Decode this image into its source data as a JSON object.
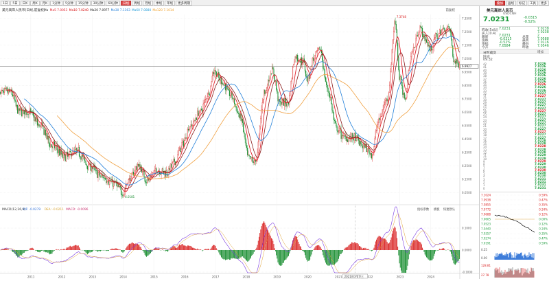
{
  "toolbar": {
    "left": [
      "1日",
      "5日",
      "日K",
      "周K",
      "月K",
      "1分钟",
      "5分钟",
      "15分钟",
      "30分钟",
      "60分钟",
      "日线",
      "周线",
      "月线",
      "季线",
      "年线",
      "更多周期"
    ],
    "active_index": 10,
    "right": [
      "叠加",
      "画线",
      "标记",
      "工具",
      "更多"
    ]
  },
  "chart": {
    "title": "美元离岸人民币",
    "subtitle": "(日线,前复权)",
    "ma_legend": [
      {
        "label": "Ma",
        "value": "",
        "color": "#333333"
      },
      {
        "label": "Ma5",
        "value": "7.0053",
        "color": "#e0202a"
      },
      {
        "label": "Ma10",
        "value": "7.0240",
        "color": "#d40000"
      },
      {
        "label": "Ma20",
        "value": "7.0977",
        "color": "#222222"
      },
      {
        "label": "Ma30",
        "value": "7.1163",
        "color": "#1f7ed8"
      },
      {
        "label": "Ma60",
        "value": "7.0880",
        "color": "#1f9bd8"
      },
      {
        "label": "Ma120",
        "value": "7.1014",
        "color": "#f0a02a"
      }
    ],
    "ma_colors": {
      "ma_fast": "#e0202a",
      "ma_mid": "#8b1a1a",
      "ma_slow": "#1f7ed8",
      "ma_long": "#f0a040"
    },
    "right_top_label": "前复权",
    "y_axis": [
      "7.3500",
      "7.2500",
      "7.1500",
      "7.0500",
      "6.9500",
      "6.8500",
      "6.7500",
      "6.6500",
      "6.5500",
      "6.4500",
      "6.3500",
      "6.2500",
      "6.1500",
      "6.0500"
    ],
    "crosshair_value": "6.9927",
    "high_label": "7.3748",
    "low_label": "6.0181",
    "x_labels": [
      "2011",
      "2012",
      "2013",
      "2014",
      "2015",
      "2016",
      "2017",
      "2018",
      "2019",
      "2020",
      "2021",
      "2022",
      "2023",
      "2024"
    ],
    "crosshair_date": "2021/07/07/三",
    "macd_title": "MACD(12,26,9)",
    "macd_values": [
      {
        "label": "DIF",
        "value": "-0.0279",
        "color": "#2b6cd6"
      },
      {
        "label": "DEA",
        "value": "-0.0211",
        "color": "#d6a02b"
      },
      {
        "label": "MACD",
        "value": "-0.0096",
        "color": "#c8306e"
      }
    ],
    "macd_buttons": [
      "指标参数",
      "模板",
      "恢复默认"
    ],
    "macd_axis": [
      "0.1000",
      "0.0000",
      "-0.1000"
    ]
  },
  "chart_data": {
    "type": "line",
    "x_range": [
      "2010",
      "2024"
    ],
    "y_range": [
      6.0,
      7.38
    ],
    "keypoints": [
      {
        "year": 2010.35,
        "price": 6.8
      },
      {
        "year": 2010.6,
        "price": 6.66
      },
      {
        "year": 2010.95,
        "price": 6.65
      },
      {
        "year": 2011.3,
        "price": 6.55
      },
      {
        "year": 2011.7,
        "price": 6.4
      },
      {
        "year": 2012.1,
        "price": 6.32
      },
      {
        "year": 2012.5,
        "price": 6.36
      },
      {
        "year": 2012.9,
        "price": 6.25
      },
      {
        "year": 2013.3,
        "price": 6.17
      },
      {
        "year": 2013.7,
        "price": 6.12
      },
      {
        "year": 2014.0,
        "price": 6.05
      },
      {
        "year": 2014.2,
        "price": 6.15
      },
      {
        "year": 2014.5,
        "price": 6.25
      },
      {
        "year": 2014.8,
        "price": 6.14
      },
      {
        "year": 2015.1,
        "price": 6.22
      },
      {
        "year": 2015.4,
        "price": 6.2
      },
      {
        "year": 2015.7,
        "price": 6.28
      },
      {
        "year": 2015.9,
        "price": 6.4
      },
      {
        "year": 2016.2,
        "price": 6.55
      },
      {
        "year": 2016.5,
        "price": 6.65
      },
      {
        "year": 2016.8,
        "price": 6.8
      },
      {
        "year": 2016.95,
        "price": 6.96
      },
      {
        "year": 2017.2,
        "price": 6.88
      },
      {
        "year": 2017.5,
        "price": 6.78
      },
      {
        "year": 2017.8,
        "price": 6.62
      },
      {
        "year": 2018.1,
        "price": 6.3
      },
      {
        "year": 2018.3,
        "price": 6.28
      },
      {
        "year": 2018.6,
        "price": 6.8
      },
      {
        "year": 2018.85,
        "price": 6.96
      },
      {
        "year": 2019.1,
        "price": 6.72
      },
      {
        "year": 2019.35,
        "price": 6.72
      },
      {
        "year": 2019.6,
        "price": 7.06
      },
      {
        "year": 2019.85,
        "price": 7.03
      },
      {
        "year": 2020.0,
        "price": 6.9
      },
      {
        "year": 2020.2,
        "price": 7.05
      },
      {
        "year": 2020.4,
        "price": 7.12
      },
      {
        "year": 2020.65,
        "price": 6.82
      },
      {
        "year": 2020.95,
        "price": 6.52
      },
      {
        "year": 2021.2,
        "price": 6.46
      },
      {
        "year": 2021.5,
        "price": 6.46
      },
      {
        "year": 2021.8,
        "price": 6.4
      },
      {
        "year": 2022.1,
        "price": 6.34
      },
      {
        "year": 2022.3,
        "price": 6.58
      },
      {
        "year": 2022.6,
        "price": 6.76
      },
      {
        "year": 2022.85,
        "price": 7.32
      },
      {
        "year": 2023.0,
        "price": 6.9
      },
      {
        "year": 2023.15,
        "price": 6.75
      },
      {
        "year": 2023.4,
        "price": 7.1
      },
      {
        "year": 2023.65,
        "price": 7.28
      },
      {
        "year": 2023.85,
        "price": 7.18
      },
      {
        "year": 2024.0,
        "price": 7.12
      },
      {
        "year": 2024.2,
        "price": 7.22
      },
      {
        "year": 2024.45,
        "price": 7.27
      },
      {
        "year": 2024.6,
        "price": 7.28
      },
      {
        "year": 2024.78,
        "price": 7.02
      }
    ]
  },
  "quote": {
    "name": "美元离岸人民币",
    "code": "USDCNH",
    "price": "7.0231",
    "change": "-0.0315",
    "change_pct": "-0.52%",
    "rows": [
      {
        "l": "昨收(5s叫)",
        "v": "7.0231",
        "l2": "",
        "v2": "7.0238"
      },
      {
        "l": "买入(0.4)",
        "v": "",
        "l2": "",
        "v2": "7.0238"
      },
      {
        "l": "最新",
        "v": "7.0231",
        "l2": "总量",
        "v2": "2"
      },
      {
        "l": "涨跌",
        "v": "-0.0315",
        "l2": "最高",
        "v2": "7.0588"
      },
      {
        "l": "涨幅",
        "v": "-0.52%",
        "l2": "最低",
        "v2": "7.0116"
      },
      {
        "l": "今开",
        "v": "7.0584",
        "l2": "昨收",
        "v2": "7.0546"
      }
    ],
    "section": "分时成交",
    "section_btn": "增加",
    "trades_time": "时间",
    "trades_head_time": "09:32",
    "trades": [
      "7.0226",
      "7.0226",
      "7.0226",
      "7.0226",
      "7.0226",
      "7.0226",
      "7.0226",
      "7.0226",
      "7.0226",
      "7.0226",
      "7.0227",
      "7.0227",
      "7.0227",
      "7.0227",
      "7.0227",
      "7.0227",
      "7.0227",
      "7.0227",
      "7.0227",
      "7.0227",
      "7.0227",
      "7.0227",
      "7.0227",
      "7.0227",
      "7.0227",
      "7.0227",
      "7.0228",
      "7.0228",
      "7.0228",
      "7.0228",
      "7.0228",
      "7.0229",
      "7.0229",
      "7.0229",
      "7.0229",
      "7.0230",
      "7.0230",
      "7.0230",
      "7.0230",
      "7.0231",
      "7.0231",
      "7.0231",
      "7.0231"
    ],
    "trade_sides": [
      "B",
      "B",
      "B",
      "B",
      "B",
      "B",
      "B",
      "S",
      "B",
      "B",
      "B",
      "S",
      "B",
      "B",
      "B",
      "B",
      "S",
      "B",
      "B",
      "B",
      "B",
      "B",
      "B",
      "S",
      "B",
      "B",
      "B",
      "B",
      "S",
      "B",
      "B",
      "B",
      "B",
      "S",
      "B",
      "B",
      "S",
      "B",
      "B",
      "B",
      "B",
      "B",
      "B"
    ],
    "mini_left": [
      "7.1024",
      "7.0938",
      "7.0855",
      "7.0772",
      "7.0688",
      "7.0605",
      "7.0523",
      "7.0440",
      "7.0357",
      "7.0274",
      "7.0191"
    ],
    "mini_right": [
      "0.59%",
      "0.47%",
      "0.35%",
      "0.24%",
      "0.12%",
      "0.00%",
      "0.12%",
      "0.24%",
      "0.35%",
      "0.47%",
      "0.59%"
    ],
    "mini_vol_top": "0.25",
    "mini_vol_mid": "0.00",
    "mini_vol_bot": "128.81",
    "mini_vol_bot2": "27.78"
  }
}
